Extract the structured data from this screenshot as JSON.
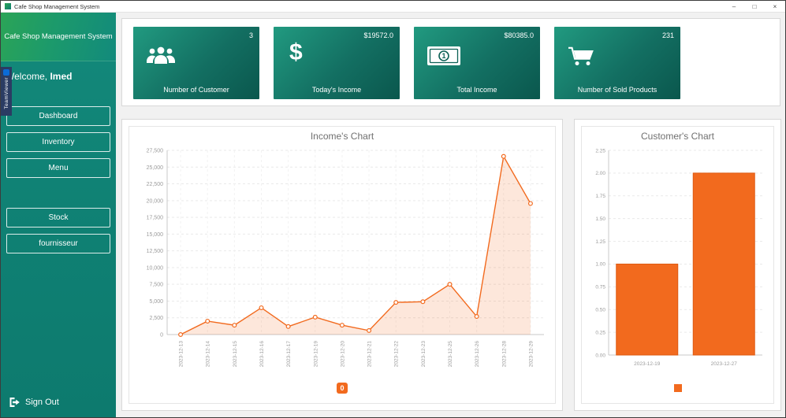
{
  "window": {
    "title": "Cafe Shop Management System",
    "minimize_label": "–",
    "maximize_label": "□",
    "close_label": "×"
  },
  "teamviewer": {
    "label": "TeamViewer"
  },
  "sidebar": {
    "app_title": "Cafe Shop Management System",
    "welcome_prefix": "Welcome, ",
    "welcome_name": "Imed",
    "items": [
      {
        "label": "Dashboard"
      },
      {
        "label": "Inventory"
      },
      {
        "label": "Menu"
      },
      {
        "label": "Stock"
      },
      {
        "label": "fournisseur"
      }
    ],
    "sign_out_label": "Sign Out"
  },
  "stats": {
    "cards": [
      {
        "icon": "customers-icon",
        "value": "3",
        "label": "Number of Customer"
      },
      {
        "icon": "dollar-icon",
        "value": "$19572.0",
        "label": "Today's Income"
      },
      {
        "icon": "banknote-icon",
        "value": "$80385.0",
        "label": "Total Income"
      },
      {
        "icon": "cart-icon",
        "value": "231",
        "label": "Number of Sold Products"
      }
    ]
  },
  "colors": {
    "accent_orange": "#f26a1e",
    "bar_stroke": "#de5a12",
    "card_gradient_start": "#219a80",
    "card_gradient_end": "#0a574d",
    "sidebar_green": "#2ba457",
    "sidebar_teal": "#0f8073"
  },
  "chart_data": [
    {
      "type": "area",
      "title": "Income's Chart",
      "x": [
        "2023-12-13",
        "2023-12-14",
        "2023-12-15",
        "2023-12-16",
        "2023-12-17",
        "2023-12-19",
        "2023-12-20",
        "2023-12-21",
        "2023-12-22",
        "2023-12-23",
        "2023-12-25",
        "2023-12-26",
        "2023-12-28",
        "2023-12-29"
      ],
      "values": [
        0,
        2000,
        1400,
        4000,
        1200,
        2600,
        1400,
        600,
        4800,
        4900,
        7500,
        2700,
        26600,
        19572
      ],
      "ylim": [
        0,
        27500
      ],
      "yticks": [
        0,
        2500,
        5000,
        7500,
        10000,
        12500,
        15000,
        17500,
        20000,
        22500,
        25000,
        27500
      ],
      "ytick_labels": [
        "0",
        "2,500",
        "5,000",
        "7,500",
        "10,000",
        "12,500",
        "15,000",
        "17,500",
        "20,000",
        "22,500",
        "25,000",
        "27,500"
      ],
      "legend": [
        "0"
      ],
      "legend_position": "bottom",
      "grid": true,
      "series_color": "#f26a1e"
    },
    {
      "type": "bar",
      "title": "Customer's Chart",
      "categories": [
        "2023-12-19",
        "2023-12-27"
      ],
      "values": [
        1,
        2
      ],
      "ylim": [
        0,
        2.25
      ],
      "yticks": [
        0,
        0.25,
        0.5,
        0.75,
        1,
        1.25,
        1.5,
        1.75,
        2,
        2.25
      ],
      "ytick_labels": [
        "0.00",
        "0.25",
        "0.50",
        "0.75",
        "1.00",
        "1.25",
        "1.50",
        "1.75",
        "2.00",
        "2.25"
      ],
      "legend": [
        ""
      ],
      "legend_position": "bottom",
      "grid": true,
      "series_color": "#f26a1e"
    }
  ]
}
